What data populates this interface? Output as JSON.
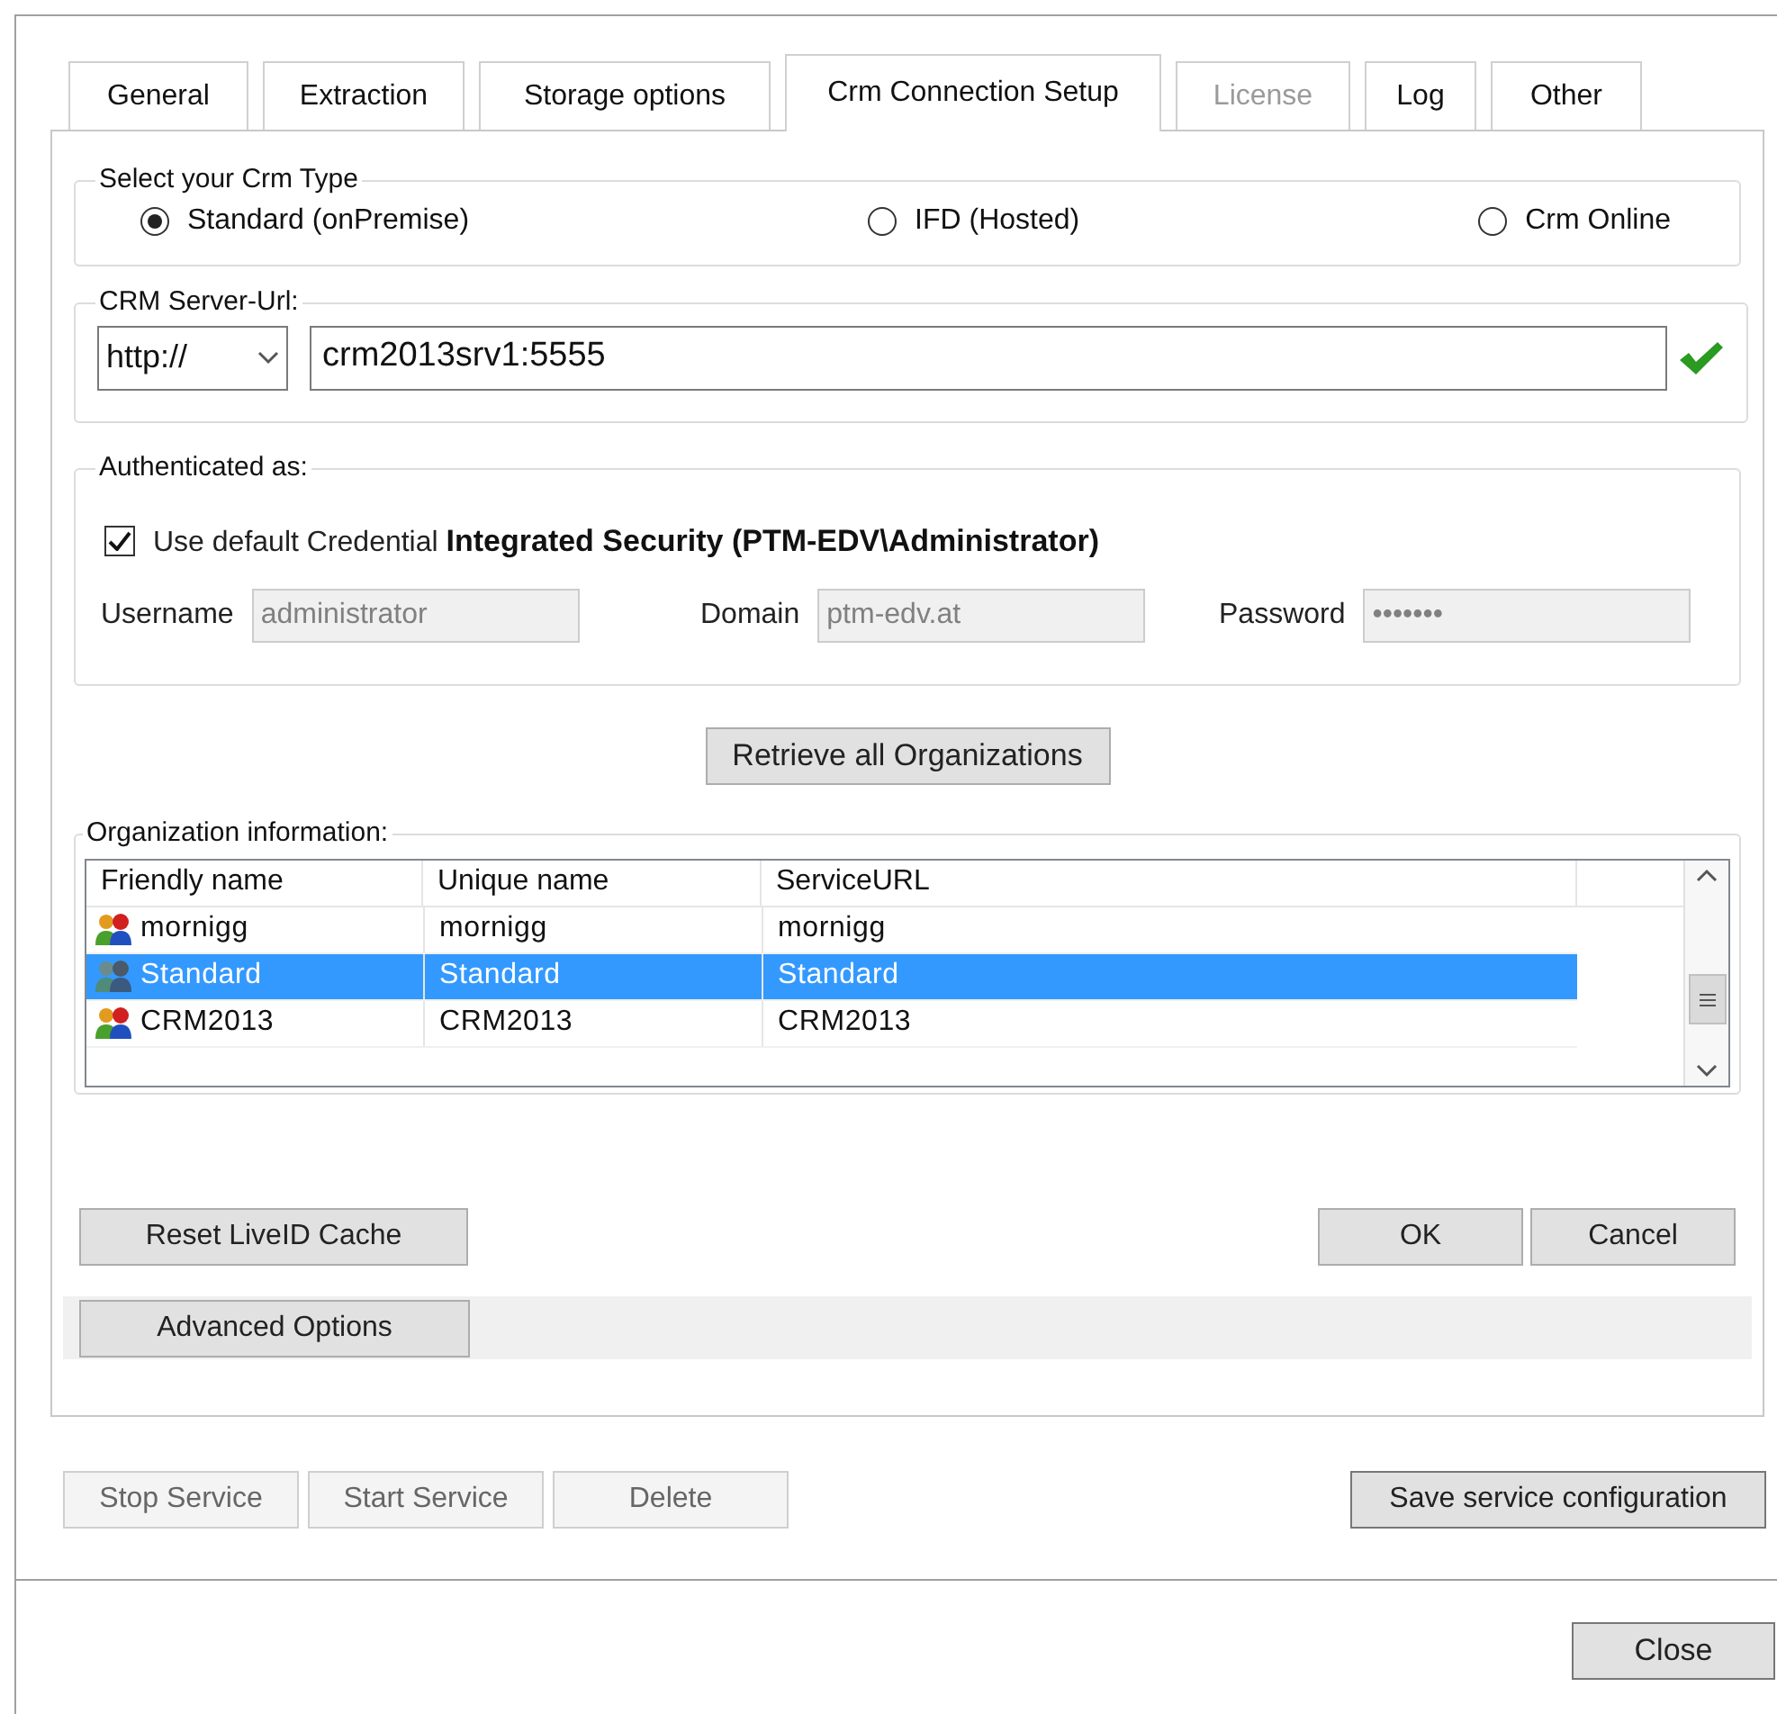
{
  "tabs": [
    {
      "label": "General",
      "selected": false,
      "disabled": false
    },
    {
      "label": "Extraction",
      "selected": false,
      "disabled": false
    },
    {
      "label": "Storage options",
      "selected": false,
      "disabled": false
    },
    {
      "label": "Crm Connection Setup",
      "selected": true,
      "disabled": false
    },
    {
      "label": "License",
      "selected": false,
      "disabled": true
    },
    {
      "label": "Log",
      "selected": false,
      "disabled": false
    },
    {
      "label": "Other",
      "selected": false,
      "disabled": false
    }
  ],
  "crm_type": {
    "legend": "Select your Crm Type",
    "options": [
      {
        "label": "Standard (onPremise)",
        "selected": true
      },
      {
        "label": "IFD (Hosted)",
        "selected": false
      },
      {
        "label": "Crm Online",
        "selected": false
      }
    ]
  },
  "server_url": {
    "legend": "CRM Server-Url:",
    "scheme": "http://",
    "value": "crm2013srv1:5555",
    "valid": true
  },
  "auth": {
    "legend": "Authenticated as:",
    "use_default": {
      "label": "Use default Credential **Integrated Security (PTM-EDV\\Administrator)**",
      "checked": true
    },
    "fields": [
      {
        "label": "Username",
        "value": "administrator",
        "disabled": true
      },
      {
        "label": "Domain",
        "value": "ptm-edv.at",
        "disabled": true
      },
      {
        "label": "Password",
        "value": "•••••••",
        "disabled": true
      }
    ]
  },
  "retrieve_button": "Retrieve all Organizations",
  "organizations": {
    "legend": "Organization information:",
    "columns": [
      "Friendly name",
      "Unique name",
      "ServiceURL"
    ],
    "rows": [
      {
        "cells": [
          "mornigg",
          "mornigg",
          "mornigg"
        ],
        "selected": false
      },
      {
        "cells": [
          "Standard",
          "Standard",
          "Standard"
        ],
        "selected": true
      },
      {
        "cells": [
          "CRM2013",
          "CRM2013",
          "CRM2013"
        ],
        "selected": false
      }
    ]
  },
  "reset_button": "Reset LiveID Cache",
  "ok_button": "OK",
  "cancel_button": "Cancel",
  "advanced_button": "Advanced Options",
  "service_buttons": [
    {
      "label": "Stop Service",
      "disabled": true
    },
    {
      "label": "Start Service",
      "disabled": true
    },
    {
      "label": "Delete",
      "disabled": true
    }
  ],
  "save_button": "Save service configuration",
  "close_button": "Close"
}
